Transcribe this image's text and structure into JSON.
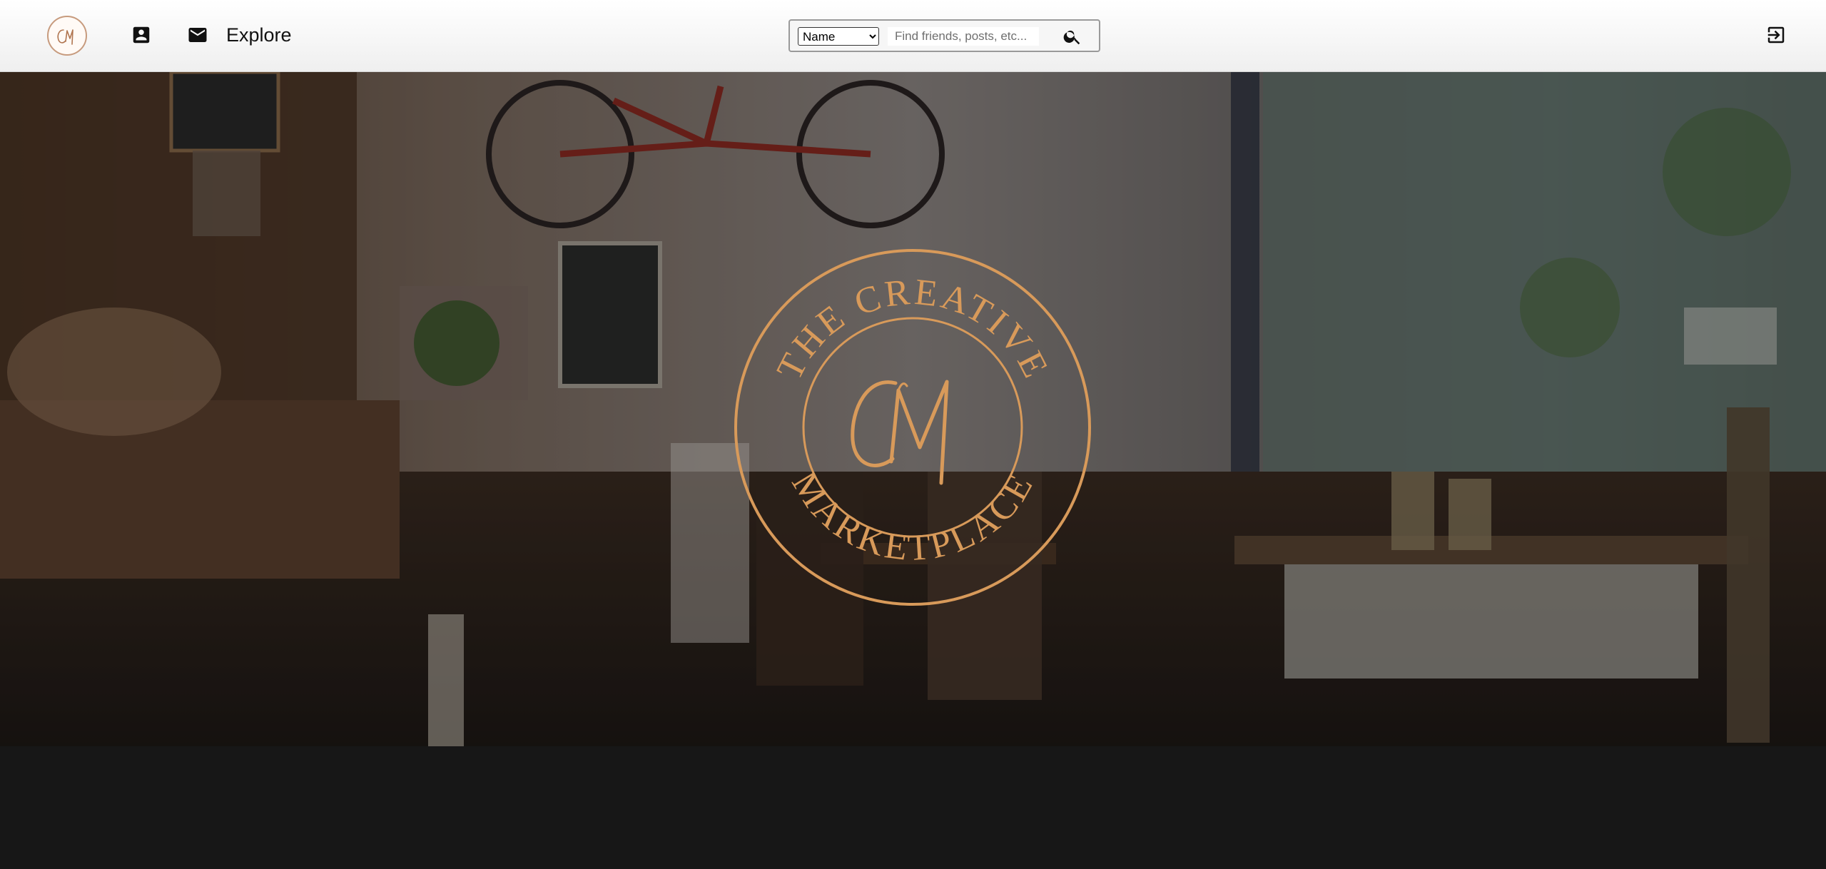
{
  "navbar": {
    "logo_icon": "cm-monogram-logo",
    "profile_icon": "account-box-icon",
    "messages_icon": "mail-icon",
    "explore_label": "Explore",
    "logout_icon": "logout-icon"
  },
  "search": {
    "select_options": [
      "Name"
    ],
    "selected": "Name",
    "placeholder": "Find friends, posts, etc...",
    "value": "",
    "button_icon": "search-icon"
  },
  "hero": {
    "emblem_text_top": "THE CREATIVE",
    "emblem_text_bottom": "MARKETPLACE",
    "emblem_monogram": "CM"
  },
  "colors": {
    "accent": "#d89a5a",
    "navbar_bg": "#f5f5f5",
    "page_bg": "#171717"
  }
}
